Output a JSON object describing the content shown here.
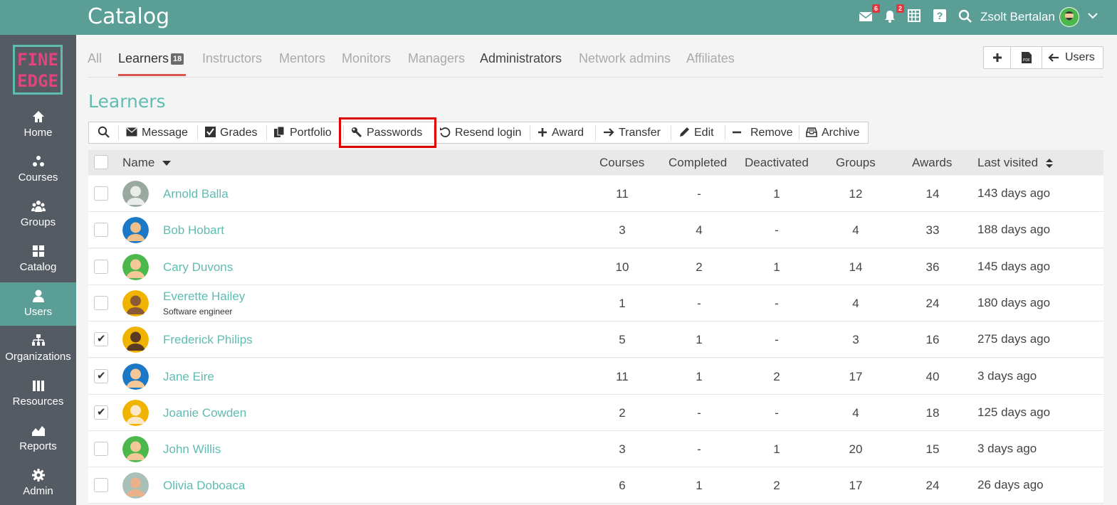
{
  "header": {
    "title": "Catalog",
    "messages_count": "6",
    "notifications_count": "2",
    "username": "Zsolt Bertalan"
  },
  "logo": {
    "line1": "FINE",
    "line2": "EDGE"
  },
  "sidebar": {
    "items": [
      {
        "label": "Home",
        "icon": "home-icon"
      },
      {
        "label": "Courses",
        "icon": "courses-icon"
      },
      {
        "label": "Groups",
        "icon": "groups-icon"
      },
      {
        "label": "Catalog",
        "icon": "catalog-icon"
      },
      {
        "label": "Users",
        "icon": "user-icon",
        "active": true
      },
      {
        "label": "Organizations",
        "icon": "organizations-icon"
      },
      {
        "label": "Resources",
        "icon": "resources-icon"
      },
      {
        "label": "Reports",
        "icon": "reports-icon"
      },
      {
        "label": "Admin",
        "icon": "gear-icon"
      }
    ]
  },
  "tabs": {
    "all": "All",
    "learners": "Learners",
    "learners_count": "18",
    "instructors": "Instructors",
    "mentors": "Mentors",
    "monitors": "Monitors",
    "managers": "Managers",
    "administrators": "Administrators",
    "network_admins": "Network admins",
    "affiliates": "Affiliates"
  },
  "top_actions": {
    "users_label": "Users"
  },
  "section_title": "Learners",
  "toolbar": {
    "message": "Message",
    "grades": "Grades",
    "portfolio": "Portfolio",
    "passwords": "Passwords",
    "resend_login": "Resend login",
    "award": "Award",
    "transfer": "Transfer",
    "edit": "Edit",
    "remove": "Remove",
    "archive": "Archive"
  },
  "table": {
    "headers": {
      "name": "Name",
      "courses": "Courses",
      "completed": "Completed",
      "deactivated": "Deactivated",
      "groups": "Groups",
      "awards": "Awards",
      "last_visited": "Last visited"
    },
    "rows": [
      {
        "name": "Arnold Balla",
        "subtitle": "",
        "checked": false,
        "courses": "11",
        "completed": "-",
        "deactivated": "1",
        "groups": "12",
        "awards": "14",
        "last_visited": "143 days ago",
        "avatar_bg": "#9aa9a0",
        "skin": "#e8ecea"
      },
      {
        "name": "Bob Hobart",
        "subtitle": "",
        "checked": false,
        "courses": "3",
        "completed": "4",
        "deactivated": "-",
        "groups": "4",
        "awards": "33",
        "last_visited": "188 days ago",
        "avatar_bg": "#1b78c6",
        "skin": "#f0c08a"
      },
      {
        "name": "Cary Duvons",
        "subtitle": "",
        "checked": false,
        "courses": "10",
        "completed": "2",
        "deactivated": "1",
        "groups": "14",
        "awards": "36",
        "last_visited": "145 days ago",
        "avatar_bg": "#4cb84c",
        "skin": "#f3c896"
      },
      {
        "name": "Everette Hailey",
        "subtitle": "Software engineer",
        "checked": false,
        "courses": "1",
        "completed": "-",
        "deactivated": "-",
        "groups": "4",
        "awards": "24",
        "last_visited": "180 days ago",
        "avatar_bg": "#f0b400",
        "skin": "#8a5a36"
      },
      {
        "name": "Frederick Philips",
        "subtitle": "",
        "checked": true,
        "courses": "5",
        "completed": "1",
        "deactivated": "-",
        "groups": "3",
        "awards": "16",
        "last_visited": "275 days ago",
        "avatar_bg": "#f0b400",
        "skin": "#5a3a22"
      },
      {
        "name": "Jane Eire",
        "subtitle": "",
        "checked": true,
        "courses": "11",
        "completed": "1",
        "deactivated": "2",
        "groups": "17",
        "awards": "40",
        "last_visited": "3 days ago",
        "avatar_bg": "#1b78c6",
        "skin": "#f3c896"
      },
      {
        "name": "Joanie Cowden",
        "subtitle": "",
        "checked": true,
        "courses": "2",
        "completed": "-",
        "deactivated": "-",
        "groups": "4",
        "awards": "18",
        "last_visited": "125 days ago",
        "avatar_bg": "#f0b400",
        "skin": "#fbe8c8"
      },
      {
        "name": "John Willis",
        "subtitle": "",
        "checked": false,
        "courses": "3",
        "completed": "-",
        "deactivated": "1",
        "groups": "20",
        "awards": "15",
        "last_visited": "3 days ago",
        "avatar_bg": "#4cb84c",
        "skin": "#f3c896"
      },
      {
        "name": "Olivia Doboaca",
        "subtitle": "",
        "checked": false,
        "courses": "6",
        "completed": "1",
        "deactivated": "2",
        "groups": "17",
        "awards": "24",
        "last_visited": "26 days ago",
        "avatar_bg": "#a9c0b8",
        "skin": "#e9b28a"
      }
    ]
  },
  "colors": {
    "accent": "#5a9e95",
    "link": "#5fbcb1",
    "sidebar": "#555b62",
    "highlight": "#e00000",
    "tab_underline": "#d9534f"
  }
}
